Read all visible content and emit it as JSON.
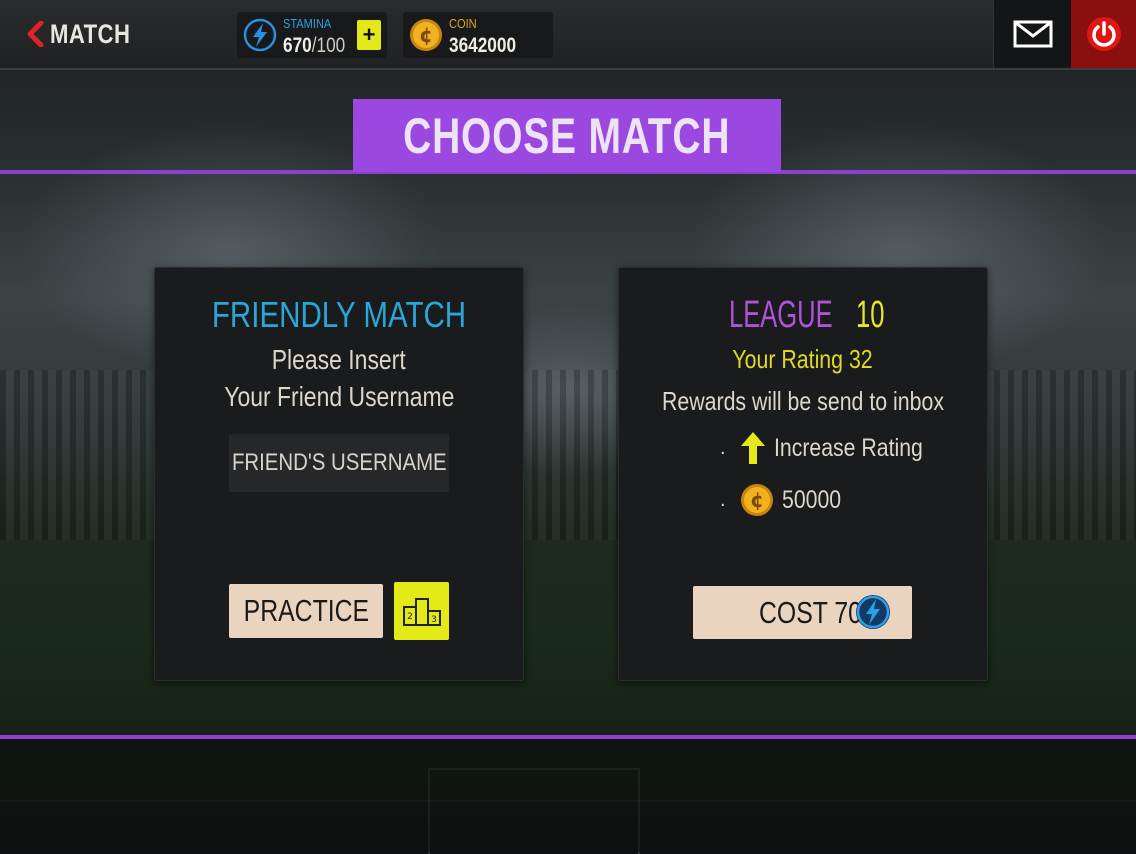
{
  "topbar": {
    "back_label": "MATCH",
    "stamina": {
      "caption": "STAMINA",
      "current": "670",
      "max": "/100",
      "plus": "+"
    },
    "coin": {
      "caption": "COIN",
      "value": "3642000"
    }
  },
  "header": {
    "title": "CHOOSE MATCH"
  },
  "friendly": {
    "title": "FRIENDLY MATCH",
    "line1": "Please Insert",
    "line2": "Your Friend Username",
    "username_placeholder": "FRIEND'S USERNAME",
    "practice_label": "PRACTICE"
  },
  "league": {
    "label": "LEAGUE",
    "number": "10",
    "rating_text": "Your Rating 32",
    "rewards_text": "Rewards will be send to inbox",
    "reward_bullet": ".",
    "reward_rating": "Increase Rating",
    "reward_coins": "50000",
    "cost_label": "COST 70"
  },
  "colors": {
    "accent_purple": "#9a48df",
    "friendly_blue": "#2aa6d8",
    "league_yellow": "#e6e62b",
    "button_cream": "#ead4c0",
    "power_red": "#8a0f0f"
  }
}
